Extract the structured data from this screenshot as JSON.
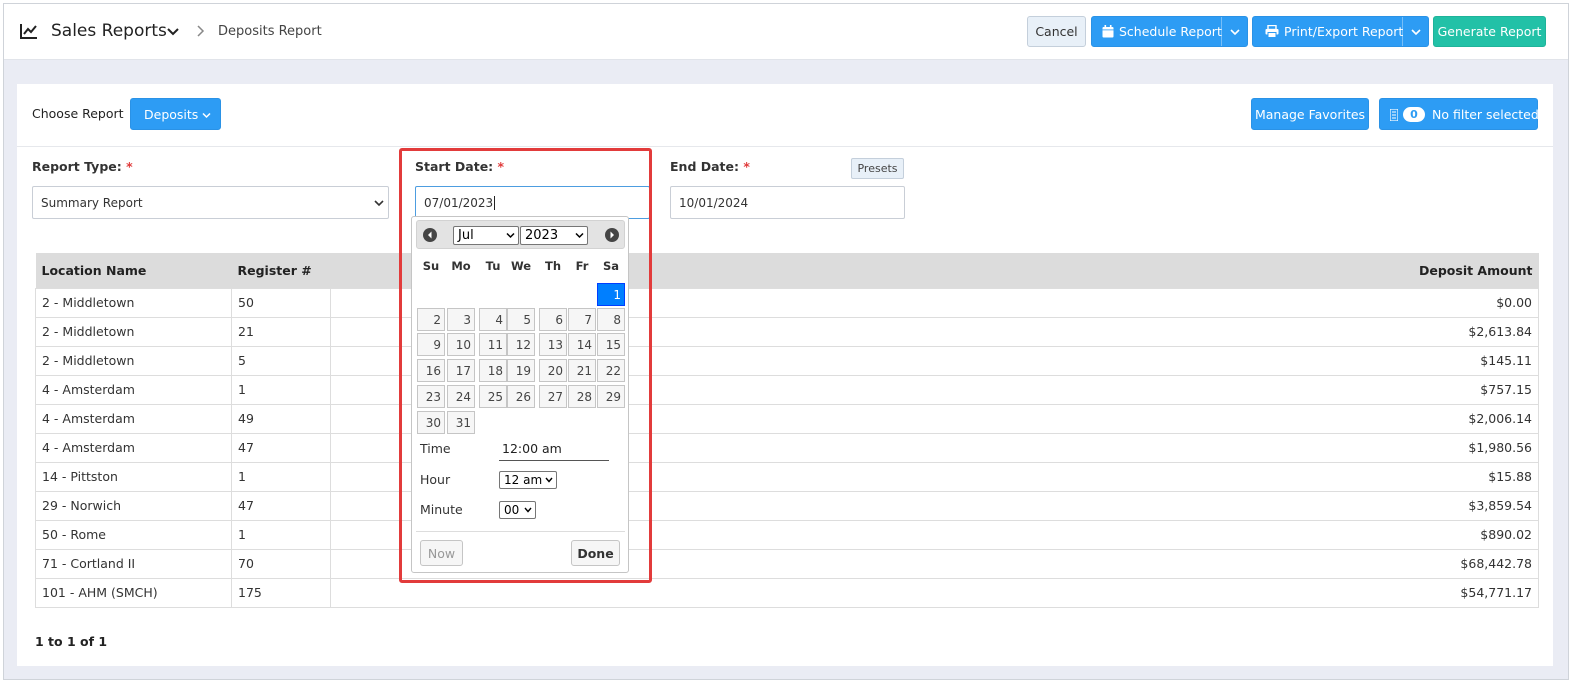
{
  "header": {
    "title": "Sales Reports",
    "breadcrumb": "Deposits Report",
    "cancel_label": "Cancel",
    "schedule_label": "Schedule Report",
    "print_label": "Print/Export Report",
    "generate_label": "Generate Report"
  },
  "toolbar": {
    "choose_label": "Choose Report",
    "report_button": "Deposits",
    "favorites_label": "Manage Favorites",
    "filter_count": "0",
    "filter_label": "No filter selected"
  },
  "form": {
    "report_type_label": "Report Type:",
    "report_type_value": "Summary Report",
    "start_label": "Start Date:",
    "start_value": "07/01/2023",
    "end_label": "End Date:",
    "end_value": "10/01/2024",
    "presets_label": "Presets",
    "required_mark": "*"
  },
  "datepicker": {
    "month": "Jul",
    "year": "2023",
    "weekdays": [
      "Su",
      "Mo",
      "Tu",
      "We",
      "Th",
      "Fr",
      "Sa"
    ],
    "days": [
      "1",
      "2",
      "3",
      "4",
      "5",
      "6",
      "7",
      "8",
      "9",
      "10",
      "11",
      "12",
      "13",
      "14",
      "15",
      "16",
      "17",
      "18",
      "19",
      "20",
      "21",
      "22",
      "23",
      "24",
      "25",
      "26",
      "27",
      "28",
      "29",
      "30",
      "31"
    ],
    "time_label": "Time",
    "time_value": "12:00 am",
    "hour_label": "Hour",
    "hour_value": "12 am",
    "minute_label": "Minute",
    "minute_value": "00",
    "now_label": "Now",
    "done_label": "Done"
  },
  "table": {
    "headers": [
      "Location Name",
      "Register #",
      "Deposit Amount"
    ],
    "rows": [
      {
        "location": "2 - Middletown",
        "register": "50",
        "amount": "$0.00"
      },
      {
        "location": "2 - Middletown",
        "register": "21",
        "amount": "$2,613.84"
      },
      {
        "location": "2 - Middletown",
        "register": "5",
        "amount": "$145.11"
      },
      {
        "location": "4 - Amsterdam",
        "register": "1",
        "amount": "$757.15"
      },
      {
        "location": "4 - Amsterdam",
        "register": "49",
        "amount": "$2,006.14"
      },
      {
        "location": "4 - Amsterdam",
        "register": "47",
        "amount": "$1,980.56"
      },
      {
        "location": "14 - Pittston",
        "register": "1",
        "amount": "$15.88"
      },
      {
        "location": "29 - Norwich",
        "register": "47",
        "amount": "$3,859.54"
      },
      {
        "location": "50 - Rome",
        "register": "1",
        "amount": "$890.02"
      },
      {
        "location": "71 - Cortland II",
        "register": "70",
        "amount": "$68,442.78"
      },
      {
        "location": "101 - AHM (SMCH)",
        "register": "175",
        "amount": "$54,771.17"
      }
    ]
  },
  "pager": "1 to 1 of 1",
  "colors": {
    "primary": "#2d9cf4",
    "teal": "#22c1a7",
    "highlight": "#e23b3b",
    "active_day": "#007fff"
  }
}
